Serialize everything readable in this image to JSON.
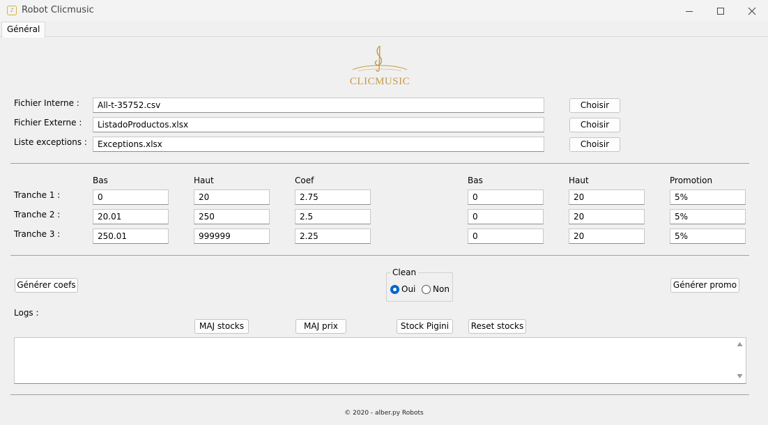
{
  "window": {
    "title": "Robot Clicmusic",
    "icon": "app-icon"
  },
  "tabs": [
    {
      "label": "Général",
      "selected": true
    }
  ],
  "logo": {
    "text": "CLICMUSIC"
  },
  "files": {
    "internal": {
      "label": "Fichier Interne :",
      "value": "All-t-35752.csv",
      "button": "Choisir"
    },
    "external": {
      "label": "Fichier Externe :",
      "value": "ListadoProductos.xlsx",
      "button": "Choisir"
    },
    "exceptions": {
      "label": "Liste exceptions :",
      "value": "Exceptions.xlsx",
      "button": "Choisir"
    }
  },
  "tranches": {
    "headers": {
      "bas": "Bas",
      "haut": "Haut",
      "coef": "Coef",
      "bas2": "Bas",
      "haut2": "Haut",
      "promotion": "Promotion"
    },
    "rows": [
      {
        "label": "Tranche 1 :",
        "bas": "0",
        "haut": "20",
        "coef": "2.75",
        "bas2": "0",
        "haut2": "20",
        "promotion": "5%"
      },
      {
        "label": "Tranche 2 :",
        "bas": "20.01",
        "haut": "250",
        "coef": "2.5",
        "bas2": "0",
        "haut2": "20",
        "promotion": "5%"
      },
      {
        "label": "Tranche 3 :",
        "bas": "250.01",
        "haut": "999999",
        "coef": "2.25",
        "bas2": "0",
        "haut2": "20",
        "promotion": "5%"
      }
    ]
  },
  "actions": {
    "generate_coefs": "Générer coefs",
    "generate_promo": "Générer promo"
  },
  "clean": {
    "legend": "Clean",
    "options": [
      {
        "label": "Oui",
        "checked": true
      },
      {
        "label": "Non",
        "checked": false
      }
    ]
  },
  "logs": {
    "label": "Logs :",
    "buttons": {
      "maj_stocks": "MAJ stocks",
      "maj_prix": "MAJ prix",
      "stock_pigini": "Stock Pigini",
      "reset_stocks": "Reset stocks"
    },
    "content": ""
  },
  "footer": {
    "text": "© 2020 - alber.py Robots"
  },
  "colors": {
    "radio_accent": "#0066c8",
    "logo_gold": "#c59a45"
  }
}
